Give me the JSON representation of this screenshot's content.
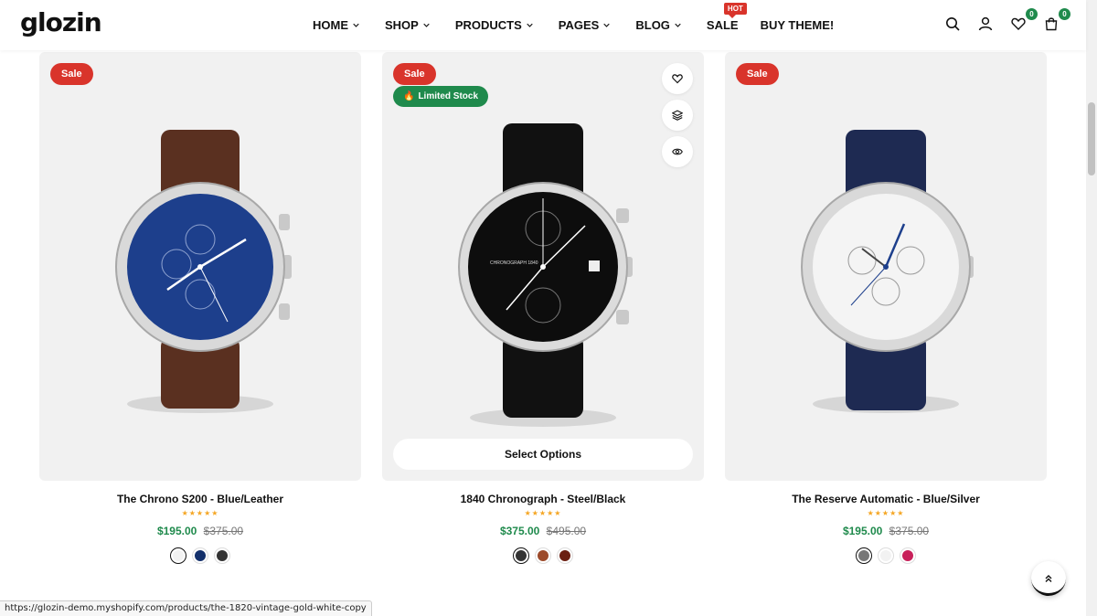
{
  "header": {
    "logo": "glozin",
    "nav": [
      {
        "label": "HOME",
        "has_dropdown": true
      },
      {
        "label": "SHOP",
        "has_dropdown": true
      },
      {
        "label": "PRODUCTS",
        "has_dropdown": true
      },
      {
        "label": "PAGES",
        "has_dropdown": true
      },
      {
        "label": "BLOG",
        "has_dropdown": true
      },
      {
        "label": "SALE",
        "has_dropdown": false,
        "badge": "HOT"
      },
      {
        "label": "BUY THEME!",
        "has_dropdown": false
      }
    ],
    "wishlist_count": "0",
    "cart_count": "0",
    "icons": [
      "search-icon",
      "user-icon",
      "heart-icon",
      "cart-icon"
    ]
  },
  "products": [
    {
      "title": "The Chrono S200 - Blue/Leather",
      "badge_sale": "Sale",
      "rating": 5,
      "stars": "★★★★★",
      "price": "$195.00",
      "compare_price": "$375.00",
      "swatches": [
        "#f2f2f2",
        "#13306b",
        "#333333"
      ],
      "active_swatch": 0,
      "dial_color": "#1d3f8c",
      "strap_color": "#5a3020"
    },
    {
      "title": "1840 Chronograph - Steel/Black",
      "badge_sale": "Sale",
      "badge_stock": "Limited Stock",
      "rating": 5,
      "stars": "★★★★★",
      "price": "$375.00",
      "compare_price": "$495.00",
      "select_options": "Select Options",
      "swatches": [
        "#333333",
        "#9c4a2a",
        "#6b1f12"
      ],
      "active_swatch": 0,
      "dial_color": "#0d0d0d",
      "strap_color": "#111111",
      "dial_text": "CHRONOGRAPH 1840"
    },
    {
      "title": "The Reserve Automatic - Blue/Silver",
      "badge_sale": "Sale",
      "rating": 5,
      "stars": "★★★★★",
      "price": "$195.00",
      "compare_price": "$375.00",
      "swatches": [
        "#777777",
        "#f2f2f2",
        "#c8205a"
      ],
      "active_swatch": 0,
      "dial_color": "#f4f4f4",
      "strap_color": "#1e2a52"
    }
  ],
  "status_url": "https://glozin-demo.myshopify.com/products/the-1820-vintage-gold-white-copy",
  "colors": {
    "sale": "#d9342b",
    "accent_green": "#1f8a4c",
    "star": "#f5a623"
  }
}
